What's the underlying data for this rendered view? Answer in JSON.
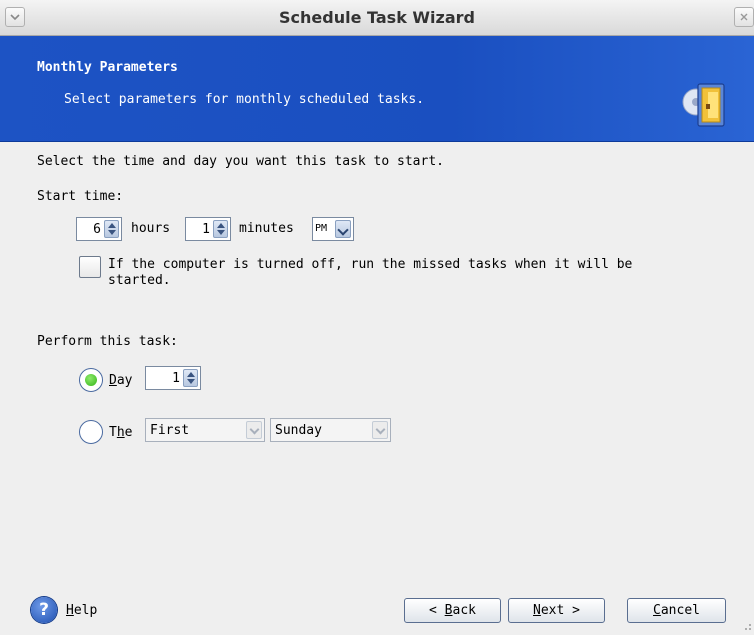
{
  "window": {
    "title": "Schedule Task Wizard",
    "menu_icon": "chevron-down-icon",
    "close_icon": "close-icon"
  },
  "header": {
    "title": "Monthly Parameters",
    "subtitle": "Select parameters for monthly scheduled tasks.",
    "icon": "schedule-disk-icon"
  },
  "body": {
    "intro": "Select the time and day you want this task to start.",
    "start_time_label": "Start time:",
    "hours_value": "6",
    "hours_label": "hours",
    "minutes_value": "1",
    "minutes_label": "minutes",
    "ampm_value": "PM",
    "missed_tasks_line1": "If the computer is turned off, run the missed tasks when it will be",
    "missed_tasks_line2": "started.",
    "missed_tasks_checked": false,
    "perform_label": "Perform this task:",
    "day_option_first": "D",
    "day_option_rest": "ay",
    "day_value": "1",
    "the_option_first": "T",
    "the_option_underlined": "h",
    "the_option_rest": "e",
    "week_value": "First",
    "weekday_value": "Sunday",
    "selected_option": "day"
  },
  "footer": {
    "help_first": "H",
    "help_rest": "elp",
    "back_prefix": "< ",
    "back_first": "B",
    "back_rest": "ack",
    "next_first": "N",
    "next_rest": "ext >",
    "cancel_first": "C",
    "cancel_rest": "ancel"
  },
  "colors": {
    "banner": "#1d53c4",
    "selected_radio": "#33b41a"
  }
}
